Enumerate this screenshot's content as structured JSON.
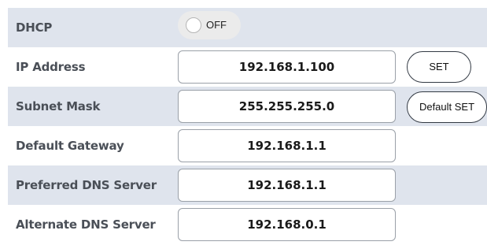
{
  "dhcp": {
    "label": "DHCP",
    "state": "OFF"
  },
  "ip_address": {
    "label": "IP Address",
    "value": "192.168.1.100"
  },
  "subnet_mask": {
    "label": "Subnet Mask",
    "value": "255.255.255.0"
  },
  "default_gateway": {
    "label": "Default Gateway",
    "value": "192.168.1.1"
  },
  "preferred_dns": {
    "label": "Preferred DNS Server",
    "value": "192.168.1.1"
  },
  "alternate_dns": {
    "label": "Alternate DNS Server",
    "value": "192.168.0.1"
  },
  "buttons": {
    "set_label": "SET",
    "default_set_label": "Default SET"
  },
  "colors": {
    "row_shade": "#dfe4ed",
    "label_text": "#4a4f57"
  }
}
